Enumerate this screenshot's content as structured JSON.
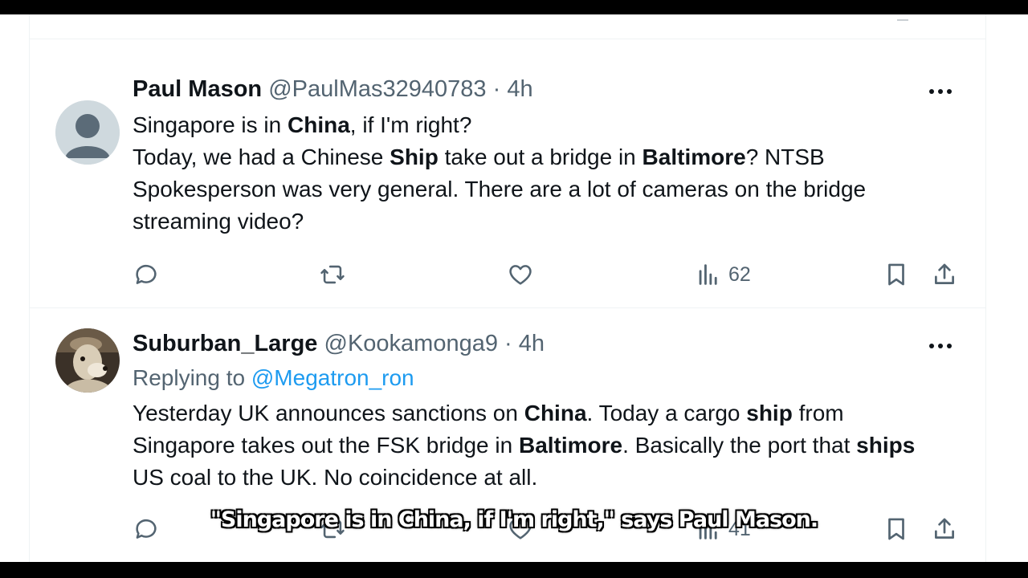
{
  "tweets": [
    {
      "name": "Paul Mason",
      "handle": "@PaulMas32940783",
      "dot": "·",
      "time": "4h",
      "avatar": "default-profile-avatar",
      "body_segments": [
        {
          "text": "Singapore is in ",
          "bold": false
        },
        {
          "text": "China",
          "bold": true
        },
        {
          "text": ", if I'm right?",
          "bold": false
        },
        {
          "text": "\n",
          "bold": false
        },
        {
          "text": "Today, we had a Chinese ",
          "bold": false
        },
        {
          "text": "Ship",
          "bold": true
        },
        {
          "text": " take out a bridge in ",
          "bold": false
        },
        {
          "text": "Baltimore",
          "bold": true
        },
        {
          "text": "? NTSB Spokesperson was very general. There are a lot of cameras on the bridge streaming video?",
          "bold": false
        }
      ],
      "views": "62"
    },
    {
      "name": "Suburban_Large",
      "handle": "@Kookamonga9",
      "dot": "·",
      "time": "4h",
      "avatar": "animal-photo-avatar",
      "replying_to_label": "Replying to",
      "replying_to_handle": "@Megatron_ron",
      "body_segments": [
        {
          "text": "Yesterday UK announces sanctions on ",
          "bold": false
        },
        {
          "text": "China",
          "bold": true
        },
        {
          "text": ". Today a cargo ",
          "bold": false
        },
        {
          "text": "ship",
          "bold": true
        },
        {
          "text": " from Singapore takes out the FSK bridge in ",
          "bold": false
        },
        {
          "text": "Baltimore",
          "bold": true
        },
        {
          "text": ". Basically the port that ",
          "bold": false
        },
        {
          "text": "ships",
          "bold": true
        },
        {
          "text": " US coal to the UK. No coincidence at all.",
          "bold": false
        }
      ],
      "views": "41"
    }
  ],
  "icons": {
    "reply": "reply-icon",
    "retweet": "retweet-icon",
    "like": "like-icon",
    "views": "views-icon",
    "bookmark": "bookmark-icon",
    "share": "share-icon",
    "more": "more-options-icon"
  },
  "caption": "\"Singapore is in China, if I'm right,\" says Paul Mason.",
  "colors": {
    "text": "#0f1419",
    "secondary": "#536471",
    "link": "#1d9bf0",
    "border": "#eff3f4"
  }
}
